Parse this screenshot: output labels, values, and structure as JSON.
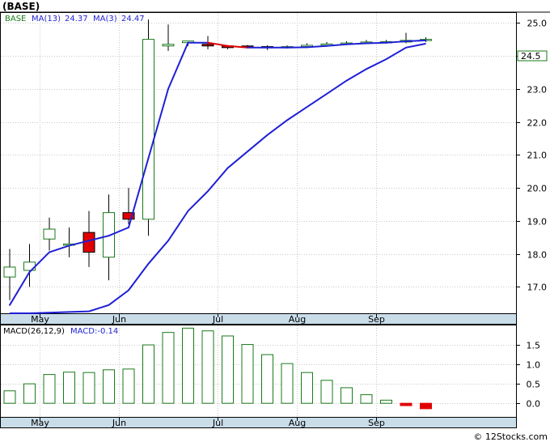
{
  "title": "(BASE)",
  "watermark": "© 12Stocks.com",
  "colors": {
    "frame": "#000000",
    "grid": "#c8c8c8",
    "axis_band": "#c9dde9",
    "up_candle": "#1a7a1a",
    "down_candle": "#e00000",
    "ma13": "#1f1fd6",
    "ma3_up": "#1f1fd6",
    "ma3_down": "#e00000",
    "macd_bar": "#1a7a1a",
    "macd_bar_neg": "#e00000",
    "symbol_text": "#1a7a1a",
    "macd_label_text": "#1f1fd6"
  },
  "legend": {
    "symbol": "BASE",
    "ma13_label": "MA(13)",
    "ma13_value": "24.37",
    "ma3_label": "MA(3)",
    "ma3_value": "24.47"
  },
  "last_price_label": "24.5",
  "macd_legend": {
    "label": "MACD(26,12,9)",
    "value_label": "MACD:-0.14"
  },
  "chart_data": [
    {
      "type": "candlestick",
      "title": "(BASE)",
      "ylim": [
        16.2,
        25.3
      ],
      "yticks": [
        "17.0",
        "18.0",
        "19.0",
        "20.0",
        "21.0",
        "22.0",
        "23.0",
        "24.0",
        "25.0"
      ],
      "ytick_values": [
        17,
        18,
        19,
        20,
        21,
        22,
        23,
        24,
        25
      ],
      "xtick_labels": [
        "May",
        "Jun",
        "Jul",
        "Aug",
        "Sep"
      ],
      "xtick_index": [
        1,
        5,
        10,
        14,
        18
      ],
      "grid": true,
      "candles": [
        {
          "o": 17.3,
          "h": 18.15,
          "l": 16.6,
          "c": 17.6
        },
        {
          "o": 17.5,
          "h": 18.3,
          "l": 17.0,
          "c": 17.75
        },
        {
          "o": 18.45,
          "h": 19.1,
          "l": 18.1,
          "c": 18.75
        },
        {
          "o": 18.3,
          "h": 18.8,
          "l": 17.9,
          "c": 18.3
        },
        {
          "o": 18.65,
          "h": 19.3,
          "l": 17.6,
          "c": 18.05
        },
        {
          "o": 17.9,
          "h": 19.8,
          "l": 17.2,
          "c": 19.25
        },
        {
          "o": 19.25,
          "h": 20.0,
          "l": 18.9,
          "c": 19.05
        },
        {
          "o": 19.05,
          "h": 25.1,
          "l": 18.55,
          "c": 24.5
        },
        {
          "o": 24.3,
          "h": 24.95,
          "l": 24.15,
          "c": 24.35
        },
        {
          "o": 24.4,
          "h": 24.45,
          "l": 24.3,
          "c": 24.45
        },
        {
          "o": 24.35,
          "h": 24.6,
          "l": 24.2,
          "c": 24.3
        },
        {
          "o": 24.3,
          "h": 24.32,
          "l": 24.2,
          "c": 24.25
        },
        {
          "o": 24.3,
          "h": 24.33,
          "l": 24.25,
          "c": 24.28
        },
        {
          "o": 24.28,
          "h": 24.32,
          "l": 24.18,
          "c": 24.25
        },
        {
          "o": 24.25,
          "h": 24.32,
          "l": 24.22,
          "c": 24.28
        },
        {
          "o": 24.28,
          "h": 24.38,
          "l": 24.25,
          "c": 24.32
        },
        {
          "o": 24.32,
          "h": 24.42,
          "l": 24.3,
          "c": 24.36
        },
        {
          "o": 24.37,
          "h": 24.44,
          "l": 24.33,
          "c": 24.39
        },
        {
          "o": 24.39,
          "h": 24.48,
          "l": 24.36,
          "c": 24.42
        },
        {
          "o": 24.42,
          "h": 24.48,
          "l": 24.37,
          "c": 24.43
        },
        {
          "o": 24.42,
          "h": 24.7,
          "l": 24.38,
          "c": 24.47
        },
        {
          "o": 24.47,
          "h": 24.56,
          "l": 24.42,
          "c": 24.5
        }
      ],
      "series": [
        {
          "name": "MA(13)",
          "values": [
            16.2,
            16.2,
            16.22,
            16.24,
            16.26,
            16.45,
            16.9,
            17.7,
            18.4,
            19.3,
            19.9,
            20.6,
            21.1,
            21.6,
            22.05,
            22.45,
            22.85,
            23.25,
            23.6,
            23.9,
            24.25,
            24.37
          ]
        },
        {
          "name": "MA(3)",
          "values": [
            16.45,
            17.45,
            18.05,
            18.25,
            18.4,
            18.55,
            18.8,
            20.9,
            23.0,
            24.4,
            24.4,
            24.3,
            24.25,
            24.25,
            24.25,
            24.26,
            24.3,
            24.35,
            24.38,
            24.4,
            24.44,
            24.47
          ]
        }
      ]
    },
    {
      "type": "bar",
      "title": "MACD(26,12,9)",
      "ylim": [
        -0.35,
        2.0
      ],
      "yticks": [
        "0.0",
        "0.5",
        "1.0",
        "1.5"
      ],
      "ytick_values": [
        0,
        0.5,
        1.0,
        1.5
      ],
      "values": [
        0.32,
        0.5,
        0.74,
        0.8,
        0.79,
        0.86,
        0.88,
        1.5,
        1.82,
        1.93,
        1.86,
        1.73,
        1.51,
        1.25,
        1.02,
        0.79,
        0.59,
        0.4,
        0.22,
        0.08,
        -0.06,
        -0.14
      ]
    }
  ]
}
